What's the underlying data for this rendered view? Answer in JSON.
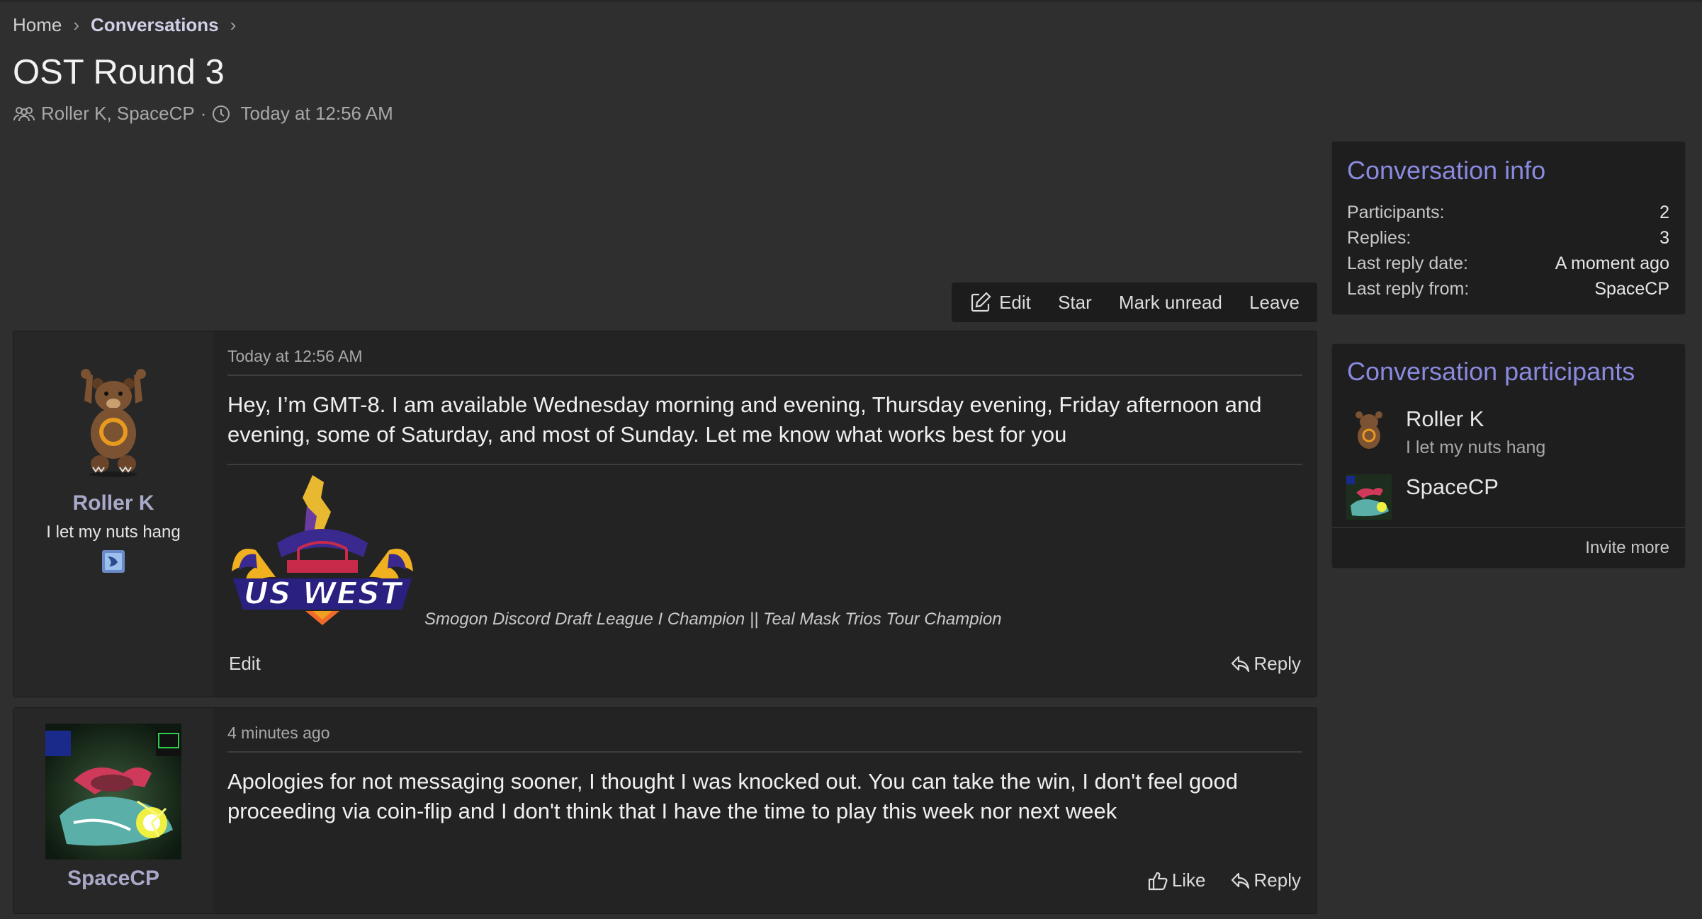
{
  "breadcrumb": {
    "home": "Home",
    "current": "Conversations",
    "sep": "›"
  },
  "title": "OST Round 3",
  "meta": {
    "participants": "Roller K, SpaceCP",
    "dot": "·",
    "date": "Today at 12:56 AM"
  },
  "actions": {
    "edit": "Edit",
    "star": "Star",
    "mark_unread": "Mark unread",
    "leave": "Leave"
  },
  "messages": [
    {
      "date": "Today at 12:56 AM",
      "user": "Roller K",
      "user_title": "I let my nuts hang",
      "body": "Hey, I’m GMT-8. I am available Wednesday morning and evening, Thursday evening, Friday afternoon and evening, some of Saturday, and most of Sunday. Let me know what works best for you",
      "signature_logo": "US WEST",
      "signature": "Smogon Discord Draft League I Champion || Teal Mask Trios Tour Champion",
      "edit_label": "Edit",
      "reply_label": "Reply"
    },
    {
      "date": "4 minutes ago",
      "user": "SpaceCP",
      "body": "Apologies for not messaging sooner, I thought I was knocked out. You can take the win, I don't feel good proceeding via coin-flip and I don't think that I have the time to play this week nor next week",
      "like_label": "Like",
      "reply_label": "Reply"
    }
  ],
  "sidebar": {
    "info": {
      "title": "Conversation info",
      "rows": [
        {
          "label": "Participants:",
          "value": "2"
        },
        {
          "label": "Replies:",
          "value": "3"
        },
        {
          "label": "Last reply date:",
          "value": "A moment ago"
        },
        {
          "label": "Last reply from:",
          "value": "SpaceCP"
        }
      ]
    },
    "participants": {
      "title": "Conversation participants",
      "list": [
        {
          "name": "Roller K",
          "title": "I let my nuts hang"
        },
        {
          "name": "SpaceCP"
        }
      ],
      "invite": "Invite more"
    }
  },
  "colors": {
    "accent": "#8a8ae0",
    "background": "#2f2f2f",
    "panel": "#1e1e1e"
  },
  "icons": [
    "users-icon",
    "clock-icon",
    "edit-icon",
    "reply-icon",
    "like-icon"
  ]
}
